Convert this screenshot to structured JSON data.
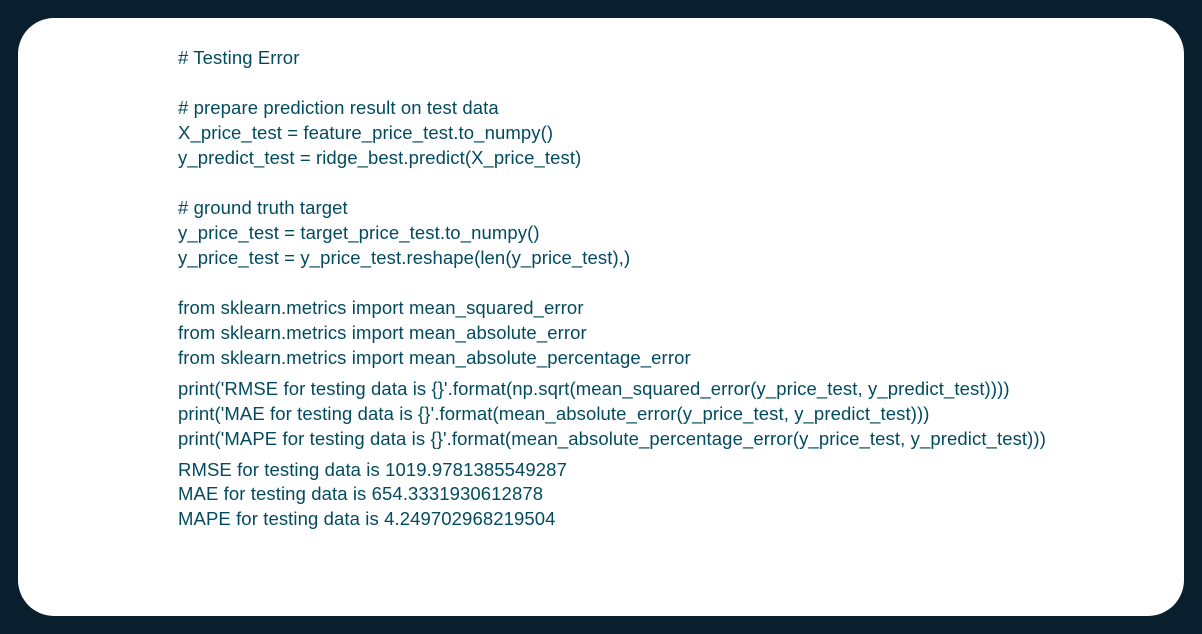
{
  "code": {
    "block1": "# Testing Error\n\n# prepare prediction result on test data\nX_price_test = feature_price_test.to_numpy()\ny_predict_test = ridge_best.predict(X_price_test)\n\n# ground truth target\ny_price_test = target_price_test.to_numpy()\ny_price_test = y_price_test.reshape(len(y_price_test),)\n\nfrom sklearn.metrics import mean_squared_error\nfrom sklearn.metrics import mean_absolute_error\nfrom sklearn.metrics import mean_absolute_percentage_error",
    "block2": "print('RMSE for testing data is {}'.format(np.sqrt(mean_squared_error(y_price_test, y_predict_test))))\nprint('MAE for testing data is {}'.format(mean_absolute_error(y_price_test, y_predict_test)))\nprint('MAPE for testing data is {}'.format(mean_absolute_percentage_error(y_price_test, y_predict_test)))"
  },
  "output": "RMSE for testing data is 1019.9781385549287\nMAE for testing data is 654.3331930612878\nMAPE for testing data is 4.249702968219504"
}
